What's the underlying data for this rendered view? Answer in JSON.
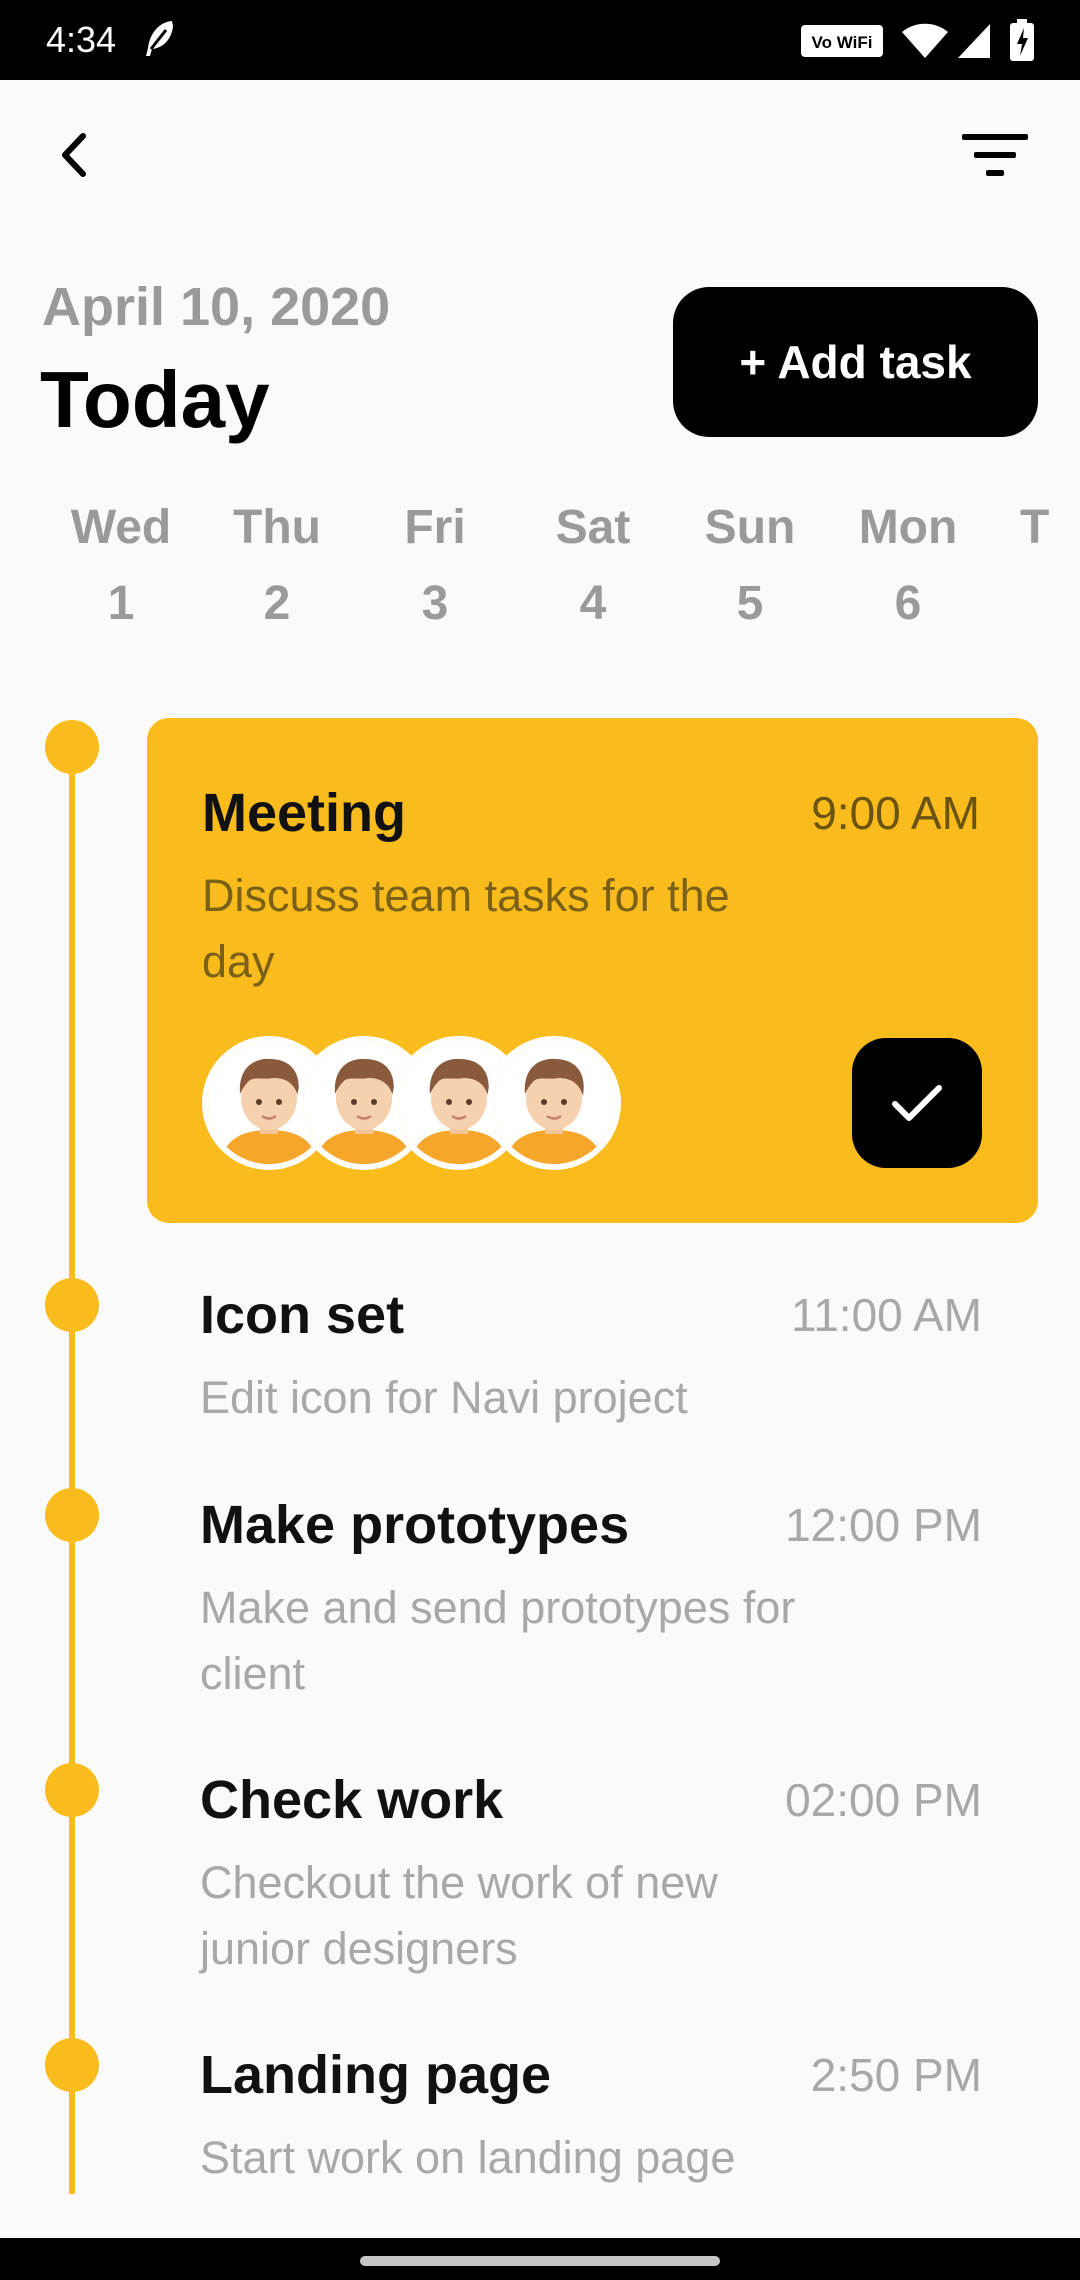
{
  "status_bar": {
    "time": "4:34",
    "wifi_badge": "Vo WiFi",
    "icons": [
      "feather-icon",
      "vowifi-icon",
      "wifi-icon",
      "signal-icon",
      "battery-icon"
    ]
  },
  "app_bar": {
    "back_icon": "back-chevron-icon",
    "filter_icon": "filter-icon"
  },
  "header": {
    "date": "April 10, 2020",
    "title": "Today",
    "add_task_label": "+ Add task"
  },
  "days": [
    {
      "name": "Wed",
      "num": "1"
    },
    {
      "name": "Thu",
      "num": "2"
    },
    {
      "name": "Fri",
      "num": "3"
    },
    {
      "name": "Sat",
      "num": "4"
    },
    {
      "name": "Sun",
      "num": "5"
    },
    {
      "name": "Mon",
      "num": "6"
    },
    {
      "name": "T",
      "num": ""
    }
  ],
  "highlight_task": {
    "title": "Meeting",
    "time": "9:00 AM",
    "description": "Discuss team tasks for the day",
    "attendee_count": 4,
    "done_icon": "check-icon"
  },
  "tasks": [
    {
      "title": "Icon set",
      "time": "11:00 AM",
      "description": "Edit icon for Navi project"
    },
    {
      "title": "Make prototypes",
      "time": "12:00 PM",
      "description": "Make and send prototypes for client"
    },
    {
      "title": "Check work",
      "time": "02:00 PM",
      "description": "Checkout the work of new junior designers"
    },
    {
      "title": "Landing page",
      "time": "2:50 PM",
      "description": "Start work on landing page"
    }
  ],
  "colors": {
    "accent": "#f9bc1c",
    "primary": "#000000",
    "muted_text": "#a8a8a8",
    "background": "#fafafa"
  }
}
